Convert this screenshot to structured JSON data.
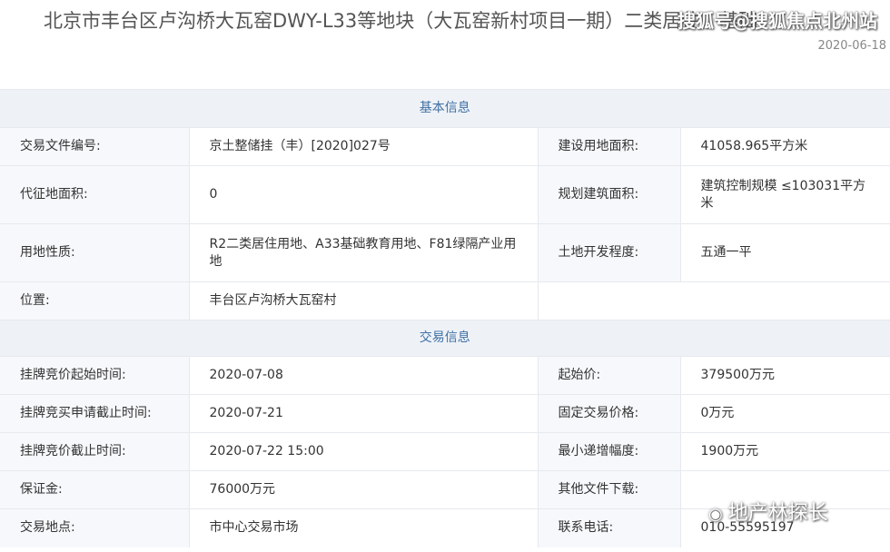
{
  "header": {
    "title": "北京市丰台区卢沟桥大瓦窑DWY-L33等地块（大瓦窑新村项目一期）二类居住、基础",
    "date": "2020-06-18",
    "watermark": "搜狐号@搜狐焦点北州站"
  },
  "basic_section": {
    "heading": "基本信息",
    "rows": [
      {
        "l1": "交易文件编号:",
        "v1": "京土整储挂（丰）[2020]027号",
        "l2": "建设用地面积:",
        "v2": "41058.965平方米"
      },
      {
        "l1": "代征地面积:",
        "v1": "0",
        "l2": "规划建筑面积:",
        "v2": "建筑控制规模 ≤103031平方米"
      },
      {
        "l1": "用地性质:",
        "v1": "R2二类居住用地、A33基础教育用地、F81绿隔产业用地",
        "l2": "土地开发程度:",
        "v2": "五通一平"
      },
      {
        "l1": "位置:",
        "v1": "丰台区卢沟桥大瓦窑村",
        "l2": "",
        "v2": ""
      }
    ]
  },
  "trade_section": {
    "heading": "交易信息",
    "rows": [
      {
        "l1": "挂牌竞价起始时间:",
        "v1": "2020-07-08",
        "l2": "起始价:",
        "v2": "379500万元"
      },
      {
        "l1": "挂牌竞买申请截止时间:",
        "v1": "2020-07-21",
        "l2": "固定交易价格:",
        "v2": "0万元"
      },
      {
        "l1": "挂牌竞价截止时间:",
        "v1": "2020-07-22 15:00",
        "l2": "最小递增幅度:",
        "v2": "1900万元"
      },
      {
        "l1": "保证金:",
        "v1": "76000万元",
        "l2": "其他文件下载:",
        "v2": ""
      },
      {
        "l1": "交易地点:",
        "v1": "市中心交易市场",
        "l2": "联系电话:",
        "v2": "010-55595197"
      }
    ]
  },
  "corner_watermark": {
    "icon": "wechat-icon",
    "text": "地产林探长"
  }
}
